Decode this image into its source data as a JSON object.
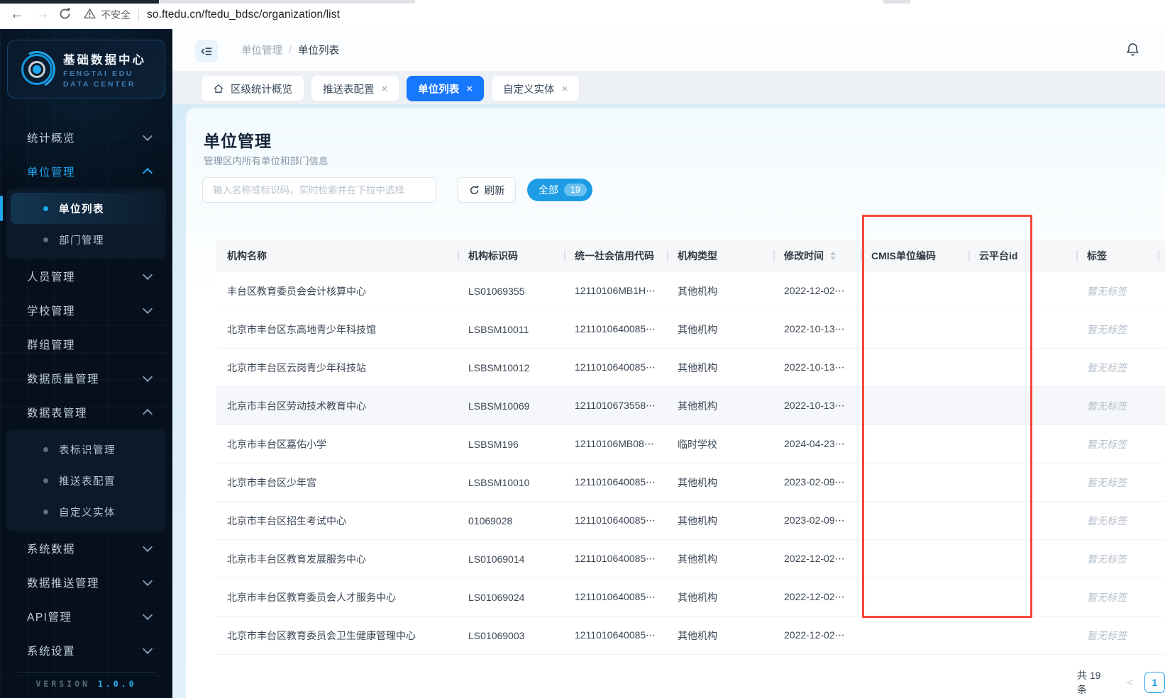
{
  "browser": {
    "back_icon": "←",
    "forward_icon": "→",
    "security_label": "不安全",
    "url": "so.ftedu.cn/ftedu_bdsc/organization/list"
  },
  "sidebar": {
    "logo": {
      "title": "基础数据中心",
      "subtitle_line1": "FENGTAI EDU",
      "subtitle_line2": "DATA CENTER"
    },
    "menu": [
      {
        "label": "统计概览",
        "chevron": "down",
        "active": false
      },
      {
        "label": "单位管理",
        "chevron": "up",
        "active": true,
        "children": [
          {
            "label": "单位列表",
            "active": true
          },
          {
            "label": "部门管理",
            "active": false
          }
        ]
      },
      {
        "label": "人员管理",
        "chevron": "down",
        "active": false
      },
      {
        "label": "学校管理",
        "chevron": "down",
        "active": false
      },
      {
        "label": "群组管理",
        "chevron": "",
        "active": false
      },
      {
        "label": "数据质量管理",
        "chevron": "down",
        "active": false
      },
      {
        "label": "数据表管理",
        "chevron": "up",
        "active": false,
        "children": [
          {
            "label": "表标识管理",
            "active": false
          },
          {
            "label": "推送表配置",
            "active": false
          },
          {
            "label": "自定义实体",
            "active": false
          }
        ]
      },
      {
        "label": "系统数据",
        "chevron": "down",
        "active": false
      },
      {
        "label": "数据推送管理",
        "chevron": "down",
        "active": false
      },
      {
        "label": "API管理",
        "chevron": "down",
        "active": false
      },
      {
        "label": "系统设置",
        "chevron": "down",
        "active": false
      }
    ],
    "version_label": "VERSION",
    "version_number": "1.0.0"
  },
  "topbar": {
    "breadcrumb_parent": "单位管理",
    "breadcrumb_separator": "/",
    "breadcrumb_current": "单位列表"
  },
  "tabs": [
    {
      "label": "区级统计概览",
      "icon": "home",
      "closable": false,
      "active": false
    },
    {
      "label": "推送表配置",
      "closable": true,
      "active": false
    },
    {
      "label": "单位列表",
      "closable": true,
      "active": true
    },
    {
      "label": "自定义实体",
      "closable": true,
      "active": false
    }
  ],
  "icons": {
    "close": "×",
    "home": "⌂"
  },
  "page": {
    "title": "单位管理",
    "subtitle": "管理区内所有单位和部门信息",
    "search_placeholder": "输入名称或标识码，实时检索并在下拉中选择",
    "refresh_label": "刷新",
    "filter_all_label": "全部",
    "filter_all_count": "19"
  },
  "table": {
    "columns": [
      "机构名称",
      "机构标识码",
      "统一社会信用代码",
      "机构类型",
      "修改时间",
      "CMIS单位编码",
      "云平台id",
      "标签"
    ],
    "rows": [
      {
        "name": "丰台区教育委员会会计核算中心",
        "code": "LS01069355",
        "credit": "12110106MB1H⋯",
        "type": "其他机构",
        "modified": "2022-12-02⋯",
        "cmis": "",
        "cloud": "",
        "tag": "暂无标签",
        "highlight": false
      },
      {
        "name": "北京市丰台区东高地青少年科技馆",
        "code": "LSBSM10011",
        "credit": "1211010640085⋯",
        "type": "其他机构",
        "modified": "2022-10-13⋯",
        "cmis": "",
        "cloud": "",
        "tag": "暂无标签",
        "highlight": false
      },
      {
        "name": "北京市丰台区云岗青少年科技站",
        "code": "LSBSM10012",
        "credit": "1211010640085⋯",
        "type": "其他机构",
        "modified": "2022-10-13⋯",
        "cmis": "",
        "cloud": "",
        "tag": "暂无标签",
        "highlight": false
      },
      {
        "name": "北京市丰台区劳动技术教育中心",
        "code": "LSBSM10069",
        "credit": "1211010673558⋯",
        "type": "其他机构",
        "modified": "2022-10-13⋯",
        "cmis": "",
        "cloud": "",
        "tag": "暂无标签",
        "highlight": true
      },
      {
        "name": "北京市丰台区嘉佑小学",
        "code": "LSBSM196",
        "credit": "12110106MB08⋯",
        "type": "临时学校",
        "modified": "2024-04-23⋯",
        "cmis": "",
        "cloud": "",
        "tag": "暂无标签",
        "highlight": false
      },
      {
        "name": "北京市丰台区少年宫",
        "code": "LSBSM10010",
        "credit": "1211010640085⋯",
        "type": "其他机构",
        "modified": "2023-02-09⋯",
        "cmis": "",
        "cloud": "",
        "tag": "暂无标签",
        "highlight": false
      },
      {
        "name": "北京市丰台区招生考试中心",
        "code": "01069028",
        "credit": "1211010640085⋯",
        "type": "其他机构",
        "modified": "2023-02-09⋯",
        "cmis": "",
        "cloud": "",
        "tag": "暂无标签",
        "highlight": false
      },
      {
        "name": "北京市丰台区教育发展服务中心",
        "code": "LS01069014",
        "credit": "1211010640085⋯",
        "type": "其他机构",
        "modified": "2022-12-02⋯",
        "cmis": "",
        "cloud": "",
        "tag": "暂无标签",
        "highlight": false
      },
      {
        "name": "北京市丰台区教育委员会人才服务中心",
        "code": "LS01069024",
        "credit": "1211010640085⋯",
        "type": "其他机构",
        "modified": "2022-12-02⋯",
        "cmis": "",
        "cloud": "",
        "tag": "暂无标签",
        "highlight": false
      },
      {
        "name": "北京市丰台区教育委员会卫生健康管理中心",
        "code": "LS01069003",
        "credit": "1211010640085⋯",
        "type": "其他机构",
        "modified": "2022-12-02⋯",
        "cmis": "",
        "cloud": "",
        "tag": "暂无标签",
        "highlight": false
      }
    ]
  },
  "pagination": {
    "total": "共 19 条",
    "prev_icon": "<",
    "page": "1"
  },
  "annotation": {
    "highlight_box_color": "#f5483b"
  },
  "colors": {
    "accent_blue": "#1677ff",
    "cyan": "#1fa8f0",
    "badge_blue": "#1d9ce6",
    "highlight_red": "#f5483b",
    "sidebar_bg": "#06101d"
  }
}
